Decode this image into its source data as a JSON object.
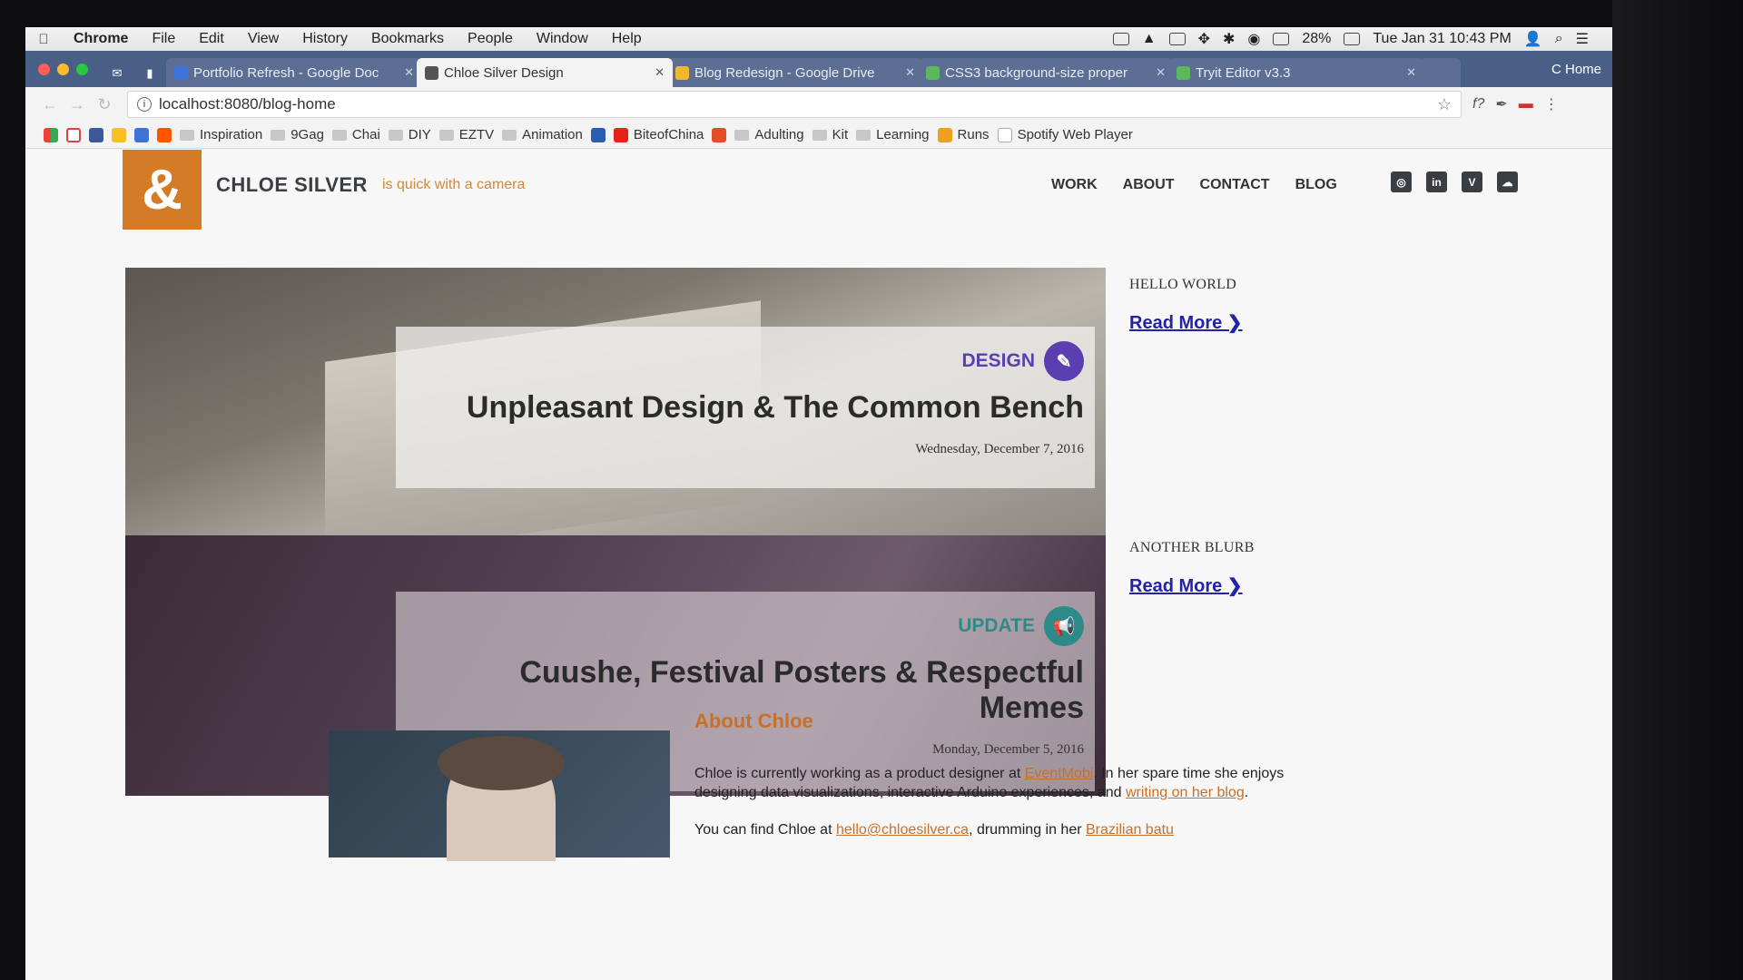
{
  "menubar": {
    "app": "Chrome",
    "items": [
      "File",
      "Edit",
      "View",
      "History",
      "Bookmarks",
      "People",
      "Window",
      "Help"
    ],
    "battery": "28%",
    "clock": "Tue Jan 31  10:43 PM"
  },
  "tabs": [
    {
      "title": "Portfolio Refresh - Google Doc",
      "color": "#3d72d9"
    },
    {
      "title": "Chloe Silver Design",
      "color": "#555555"
    },
    {
      "title": "Blog Redesign - Google Drive",
      "color": "#f1b82d"
    },
    {
      "title": "CSS3 background-size proper",
      "color": "#5cb85c"
    },
    {
      "title": "Tryit Editor v3.3",
      "color": "#5cb85c"
    }
  ],
  "profile_label": "C Home",
  "url": "localhost:8080/blog-home",
  "bookmarks": [
    "Inspiration",
    "9Gag",
    "Chai",
    "DIY",
    "EZTV",
    "Animation",
    "BiteofChina",
    "Adulting",
    "Kit",
    "Learning",
    "Runs",
    "Spotify Web Player"
  ],
  "site": {
    "logo_glyph": "&",
    "name": "CHLOE SILVER",
    "tagline": "is quick with a camera",
    "nav": [
      "WORK",
      "ABOUT",
      "CONTACT",
      "BLOG"
    ],
    "social": [
      "instagram-icon",
      "linkedin-icon",
      "vimeo-icon",
      "soundcloud-icon"
    ],
    "accent": "#d47b26"
  },
  "posts": [
    {
      "category": "DESIGN",
      "category_color": "#5b3fb0",
      "title": "Unpleasant Design & The Common Bench",
      "date": "Wednesday, December 7, 2016"
    },
    {
      "category": "UPDATE",
      "category_color": "#2e8a88",
      "title": "Cuushe, Festival Posters & Respectful Memes",
      "date": "Monday, December 5, 2016"
    }
  ],
  "sidebar": [
    {
      "heading": "HELLO WORLD",
      "link": "Read More ❯"
    },
    {
      "heading": "ANOTHER BLURB",
      "link": "Read More ❯"
    }
  ],
  "about": {
    "heading": "About Chloe",
    "p1_a": "Chloe is currently working as a product designer at ",
    "p1_link1": "EventMobi",
    "p1_b": ". In her spare time she enjoys designing data visualizations, interactive Arduino experiences, and ",
    "p1_link2": "writing on her blog",
    "p1_c": ".",
    "p2_a": "You can find Chloe at ",
    "p2_link1": "hello@chloesilver.ca",
    "p2_b": ", drumming in her ",
    "p2_link2": "Brazilian batu"
  }
}
